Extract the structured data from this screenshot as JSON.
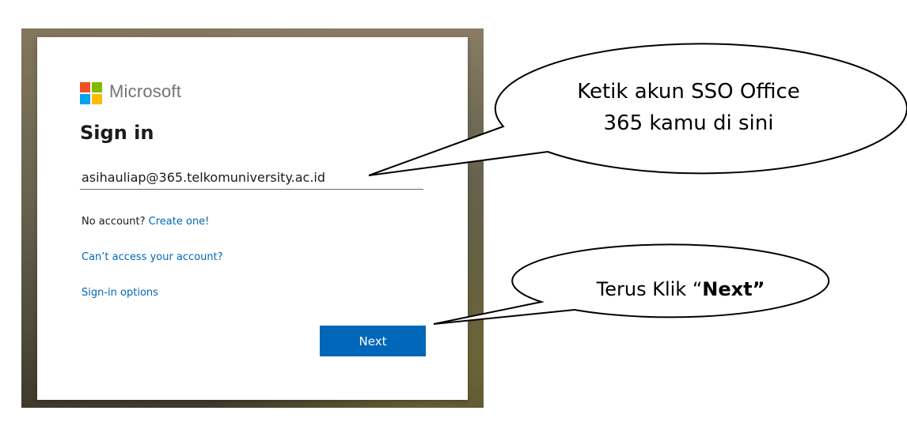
{
  "brand": {
    "name": "Microsoft",
    "logo_colors": [
      "#f25022",
      "#7fba00",
      "#00a4ef",
      "#ffb900"
    ]
  },
  "signin": {
    "title": "Sign in",
    "email_value": "asihauliap@365.telkomuniversity.ac.id",
    "no_account_text": "No account?",
    "create_link": "Create one!",
    "cant_access_link": "Can’t access your account?",
    "signin_options_link": "Sign-in options",
    "next_label": "Next"
  },
  "colors": {
    "accent": "#0067b8",
    "text": "#1b1b1b"
  },
  "callouts": {
    "email_line1": "Ketik akun SSO Office",
    "email_line2": "365 kamu di sini",
    "next_prefix": "Terus Klik “",
    "next_bold": "Next”"
  }
}
